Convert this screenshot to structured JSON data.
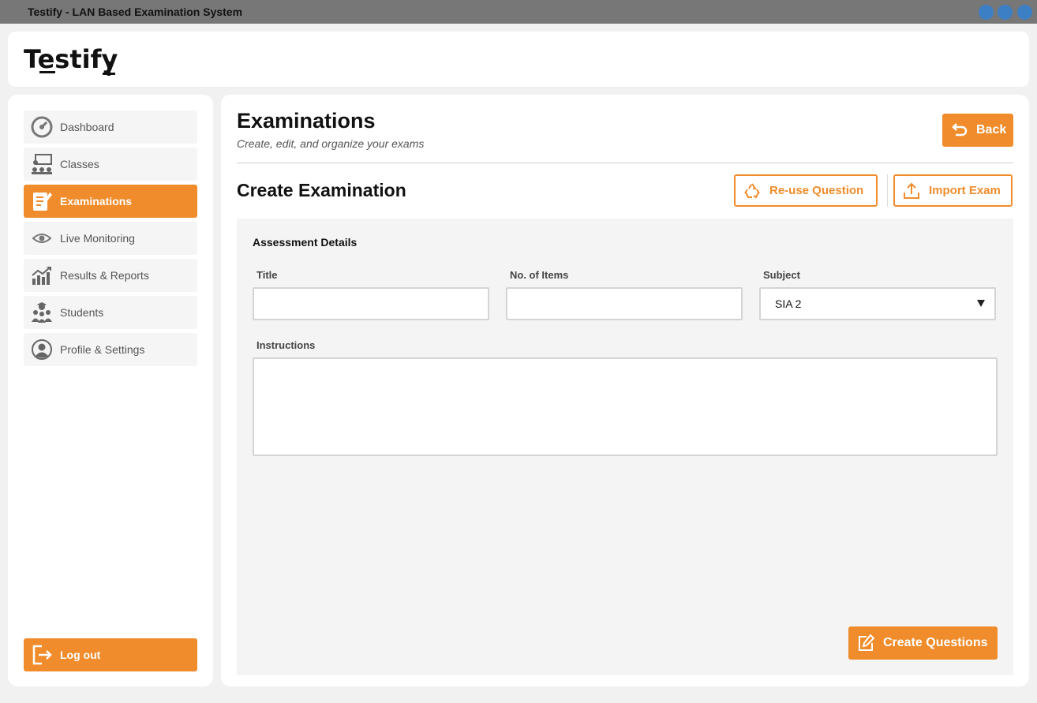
{
  "window": {
    "title": "Testify - LAN Based Examination System"
  },
  "logo": {
    "text": "Testify"
  },
  "sidebar": {
    "items": [
      {
        "label": "Dashboard",
        "icon": "speedometer-icon"
      },
      {
        "label": "Classes",
        "icon": "classroom-icon"
      },
      {
        "label": "Examinations",
        "icon": "exam-paper-icon",
        "active": true
      },
      {
        "label": "Live Monitoring",
        "icon": "eye-icon"
      },
      {
        "label": "Results & Reports",
        "icon": "chart-trend-icon"
      },
      {
        "label": "Students",
        "icon": "students-icon"
      },
      {
        "label": "Profile & Settings",
        "icon": "user-circle-icon"
      }
    ],
    "logout_label": "Log out"
  },
  "header": {
    "title": "Examinations",
    "subtitle": "Create, edit, and organize your exams",
    "back_label": "Back"
  },
  "section": {
    "title": "Create Examination",
    "reuse_label": "Re-use Question",
    "import_label": "Import Exam"
  },
  "form": {
    "panel_title": "Assessment Details",
    "title_label": "Title",
    "title_value": "",
    "items_label": "No. of Items",
    "items_value": "",
    "subject_label": "Subject",
    "subject_value": "SIA 2",
    "instructions_label": "Instructions",
    "instructions_value": "",
    "create_label": "Create Questions"
  },
  "colors": {
    "accent": "#f08c2b",
    "window_control": "#3d7fc4",
    "titlebar": "#777777"
  }
}
